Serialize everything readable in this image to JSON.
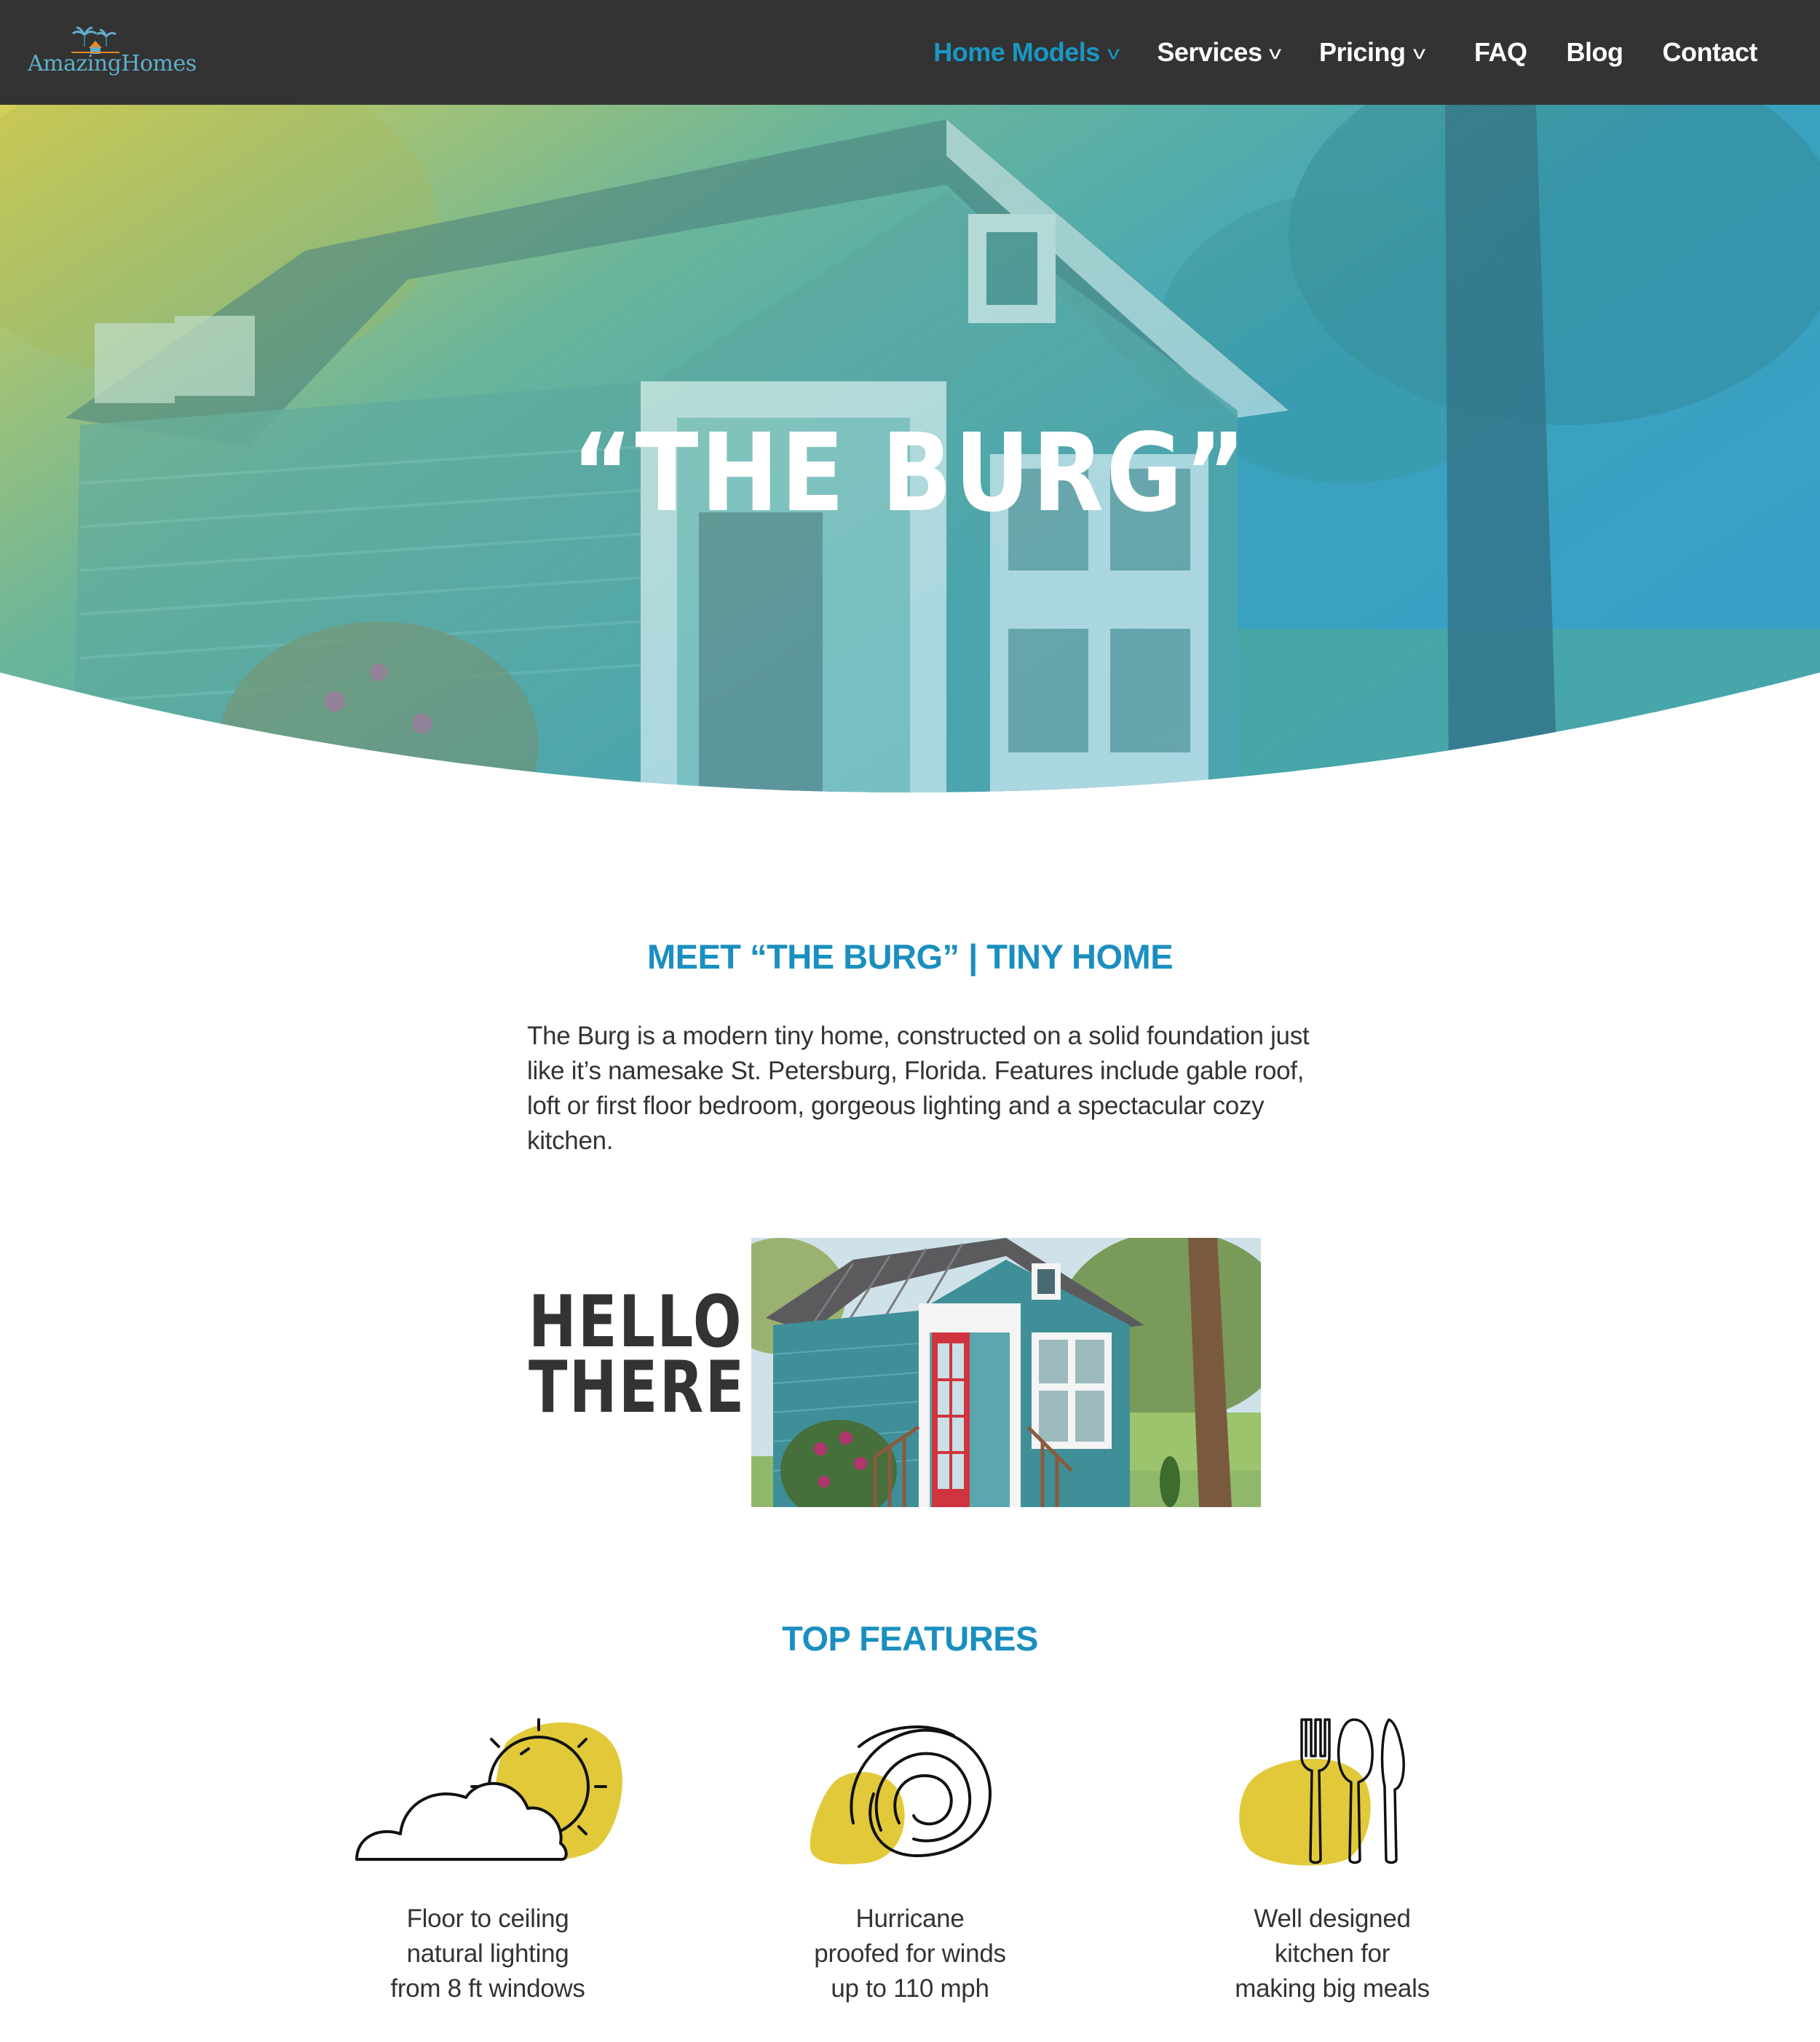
{
  "brand": {
    "logo_text": "AmazingHomes"
  },
  "nav": {
    "items": [
      {
        "label": "Home Models",
        "has_dropdown": true,
        "active": true
      },
      {
        "label": "Services",
        "has_dropdown": true,
        "active": false
      },
      {
        "label": "Pricing",
        "has_dropdown": true,
        "active": false
      },
      {
        "label": "FAQ",
        "has_dropdown": false,
        "active": false
      },
      {
        "label": "Blog",
        "has_dropdown": false,
        "active": false
      },
      {
        "label": "Contact",
        "has_dropdown": false,
        "active": false
      }
    ],
    "caret_glyph": "v"
  },
  "hero": {
    "title": "“THE BURG”"
  },
  "meet": {
    "heading": "MEET “THE BURG” | TINY HOME",
    "body": "The Burg is a modern tiny home, constructed on a solid foundation just like it’s namesake St. Petersburg, Florida. Features include gable roof, loft or first floor bedroom, gorgeous lighting and a spectacular cozy kitchen."
  },
  "hello": {
    "line1": "HELLO",
    "line2": "THERE!"
  },
  "features": {
    "heading": "TOP FEATURES",
    "items": [
      {
        "icon": "sun-cloud-icon",
        "lines": [
          "Floor to ceiling",
          "natural lighting",
          "from 8 ft windows"
        ]
      },
      {
        "icon": "hurricane-spiral-icon",
        "lines": [
          "Hurricane",
          "proofed for winds",
          "up to 110 mph"
        ]
      },
      {
        "icon": "cutlery-icon",
        "lines": [
          "Well designed",
          "kitchen for",
          "making big meals"
        ]
      }
    ]
  },
  "colors": {
    "nav_bg": "#333333",
    "accent_blue": "#1a8fbf",
    "accent_yellow": "#e2c93a",
    "text": "#333333"
  }
}
